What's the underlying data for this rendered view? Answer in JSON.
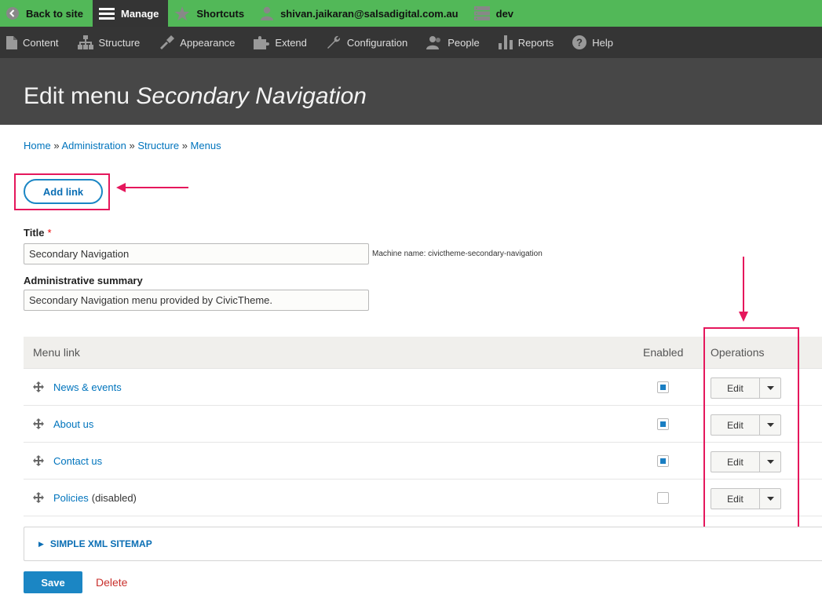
{
  "toolbar": {
    "back": "Back to site",
    "manage": "Manage",
    "shortcuts": "Shortcuts",
    "user": "shivan.jaikaran@salsadigital.com.au",
    "env": "dev"
  },
  "tray": [
    "Content",
    "Structure",
    "Appearance",
    "Extend",
    "Configuration",
    "People",
    "Reports",
    "Help"
  ],
  "page": {
    "title_prefix": "Edit menu",
    "title_name": "Secondary Navigation"
  },
  "breadcrumb": [
    "Home",
    "Administration",
    "Structure",
    "Menus"
  ],
  "breadcrumb_sep": "»",
  "actions": {
    "add_link": "Add link"
  },
  "form": {
    "title_label": "Title",
    "required_mark": "*",
    "title_value": "Secondary Navigation",
    "machine_name": "Machine name: civictheme-secondary-navigation",
    "summary_label": "Administrative summary",
    "summary_value": "Secondary Navigation menu provided by CivicTheme."
  },
  "table": {
    "headers": {
      "link": "Menu link",
      "enabled": "Enabled",
      "operations": "Operations"
    },
    "rows": [
      {
        "label": "News & events",
        "suffix": "",
        "enabled": true,
        "op": "Edit"
      },
      {
        "label": "About us",
        "suffix": "",
        "enabled": true,
        "op": "Edit"
      },
      {
        "label": "Contact us",
        "suffix": "",
        "enabled": true,
        "op": "Edit"
      },
      {
        "label": "Policies",
        "suffix": "(disabled)",
        "enabled": false,
        "op": "Edit"
      }
    ]
  },
  "sitemap": {
    "label": "SIMPLE XML SITEMAP"
  },
  "buttons": {
    "save": "Save",
    "delete": "Delete"
  },
  "colors": {
    "accent": "#e5175c",
    "toolbar": "#52b858",
    "link": "#0074bd",
    "primary": "#1b86c4"
  }
}
